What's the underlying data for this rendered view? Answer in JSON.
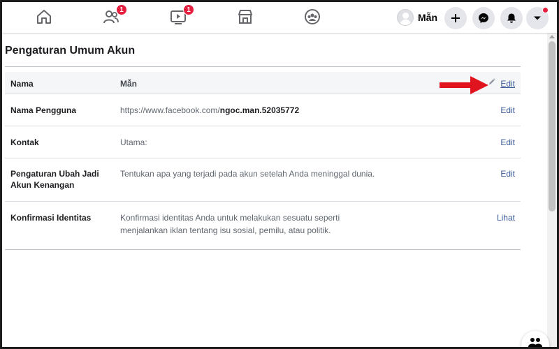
{
  "nav": {
    "icons": [
      {
        "name": "home-icon"
      },
      {
        "name": "friends-icon",
        "badge": "1"
      },
      {
        "name": "watch-icon",
        "badge": "1"
      },
      {
        "name": "marketplace-icon"
      },
      {
        "name": "groups-icon"
      }
    ],
    "profile_name": "Mẫn"
  },
  "page": {
    "title": "Pengaturan Umum Akun"
  },
  "settings": [
    {
      "label": "Nama",
      "value": "Mẫn",
      "action": "Edit"
    },
    {
      "label": "Nama Pengguna",
      "value_prefix": "https://www.facebook.com/",
      "value_bold": "ngoc.man.52035772",
      "action": "Edit"
    },
    {
      "label": "Kontak",
      "value": "Utama:",
      "action": "Edit"
    },
    {
      "label": "Pengaturan Ubah Jadi Akun Kenangan",
      "value": "Tentukan apa yang terjadi pada akun setelah Anda meninggal dunia.",
      "action": "Edit"
    },
    {
      "label": "Konfirmasi Identitas",
      "value": "Konfirmasi identitas Anda untuk melakukan sesuatu seperti menjalankan iklan tentang isu sosial, pemilu, atau politik.",
      "action": "Lihat"
    }
  ],
  "colors": {
    "link": "#385898",
    "badge": "#e41e3f",
    "arrow": "#e0141e"
  }
}
